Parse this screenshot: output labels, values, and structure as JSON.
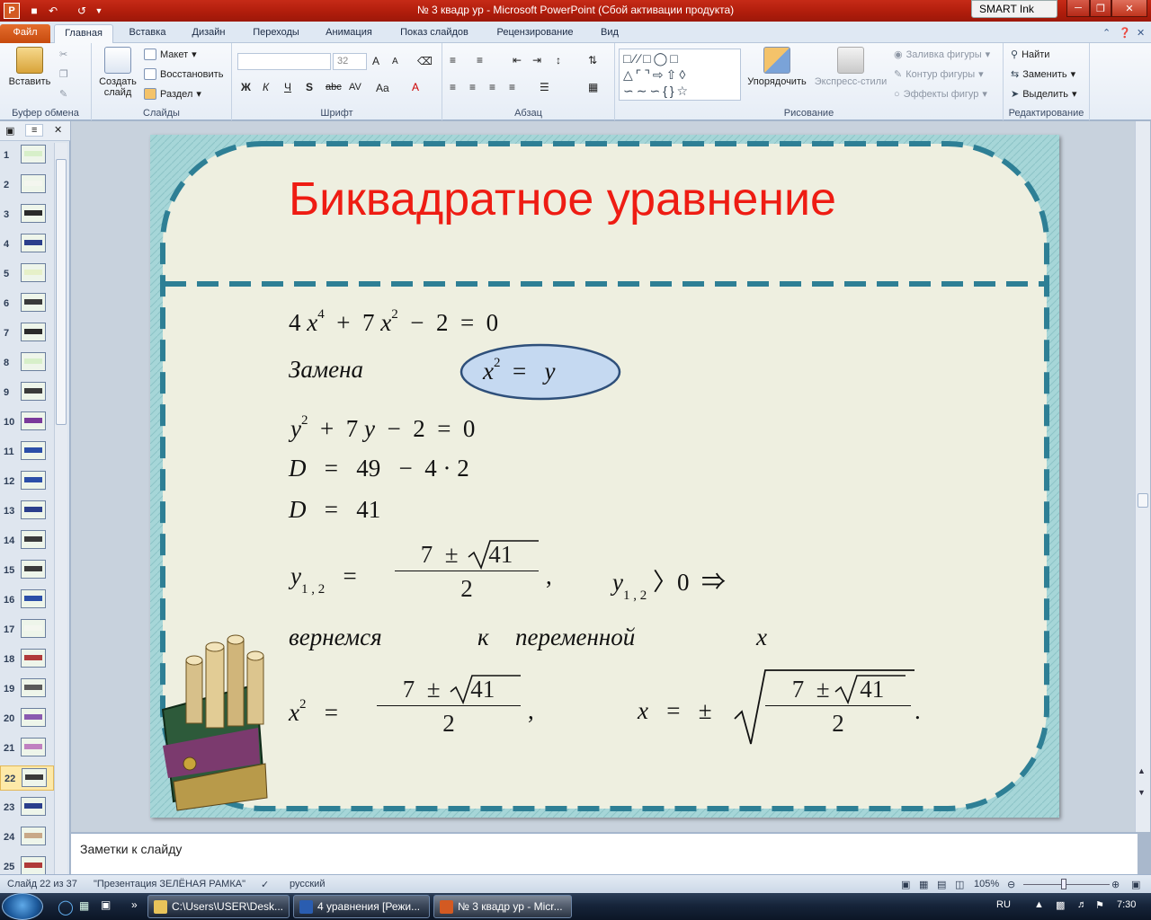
{
  "window": {
    "title": "№ 3 квадр ур  -  Microsoft PowerPoint (Сбой активации продукта)",
    "smart_ink": "SMART Ink",
    "app_icon_letter": "P"
  },
  "tabs": [
    "Файл",
    "Главная",
    "Вставка",
    "Дизайн",
    "Переходы",
    "Анимация",
    "Показ слайдов",
    "Рецензирование",
    "Вид"
  ],
  "ribbon": {
    "clipboard": {
      "label": "Буфер обмена",
      "paste": "Вставить"
    },
    "slides": {
      "label": "Слайды",
      "new_slide_1": "Создать",
      "new_slide_2": "слайд",
      "layout": "Макет",
      "reset": "Восстановить",
      "section": "Раздел"
    },
    "font": {
      "label": "Шрифт",
      "size": "32",
      "bold": "Ж",
      "italic": "К",
      "underline": "Ч",
      "shadow": "S",
      "strike": "abc",
      "spacing": "AV",
      "case": "Aa",
      "grow": "A",
      "shrink": "A",
      "color": "A"
    },
    "paragraph": {
      "label": "Абзац"
    },
    "drawing": {
      "label": "Рисование",
      "arrange": "Упорядочить",
      "quick_styles": "Экспресс-стили",
      "fill": "Заливка фигуры",
      "outline": "Контур фигуры",
      "effects": "Эффекты фигур"
    },
    "editing": {
      "label": "Редактирование",
      "find": "Найти",
      "replace": "Заменить",
      "select": "Выделить"
    }
  },
  "thumbnails": [
    "1",
    "2",
    "3",
    "4",
    "5",
    "6",
    "7",
    "8",
    "9",
    "10",
    "11",
    "12",
    "13",
    "14",
    "15",
    "16",
    "17",
    "18",
    "19",
    "20",
    "21",
    "22",
    "23",
    "24",
    "25"
  ],
  "selected_slide": "22",
  "slide": {
    "title": "Биквадратное уравнение",
    "eq1": {
      "a": "4",
      "x": "x",
      "p4": "4",
      "plus": "+",
      "b": "7",
      "p2": "2",
      "minus": "−",
      "c": "2",
      "eq": "=",
      "zero": "0"
    },
    "substitution": {
      "label": "Замена",
      "x": "x",
      "p2": "2",
      "eq": "=",
      "y": "y"
    },
    "eq2": {
      "y": "y",
      "p2": "2",
      "plus": "+",
      "b": "7",
      "minus": "−",
      "c": "2",
      "eq": "=",
      "zero": "0"
    },
    "disc1": {
      "d": "D",
      "eq": "=",
      "a": "49",
      "minus": "−",
      "b": "4",
      "dot": "·",
      "c": "2"
    },
    "disc2": {
      "d": "D",
      "eq": "=",
      "v": "41"
    },
    "roots_y": {
      "y": "y",
      "sub": "1 , 2",
      "eq": "=",
      "num_a": "7",
      "pm": "±",
      "root": "41",
      "den": "2",
      "comma": ",",
      "gt": "〉0",
      "implies": "⇒"
    },
    "back": {
      "w1": "вернемся",
      "w2": "к",
      "w3": "переменной",
      "w4": "x"
    },
    "roots_x2": {
      "x": "x",
      "p2": "2",
      "eq": "=",
      "num_a": "7",
      "pm": "±",
      "root": "41",
      "den": "2",
      "comma": ","
    },
    "roots_x": {
      "x": "x",
      "eq": "=",
      "pm": "±",
      "num_a": "7",
      "pm2": "±",
      "root": "41",
      "den": "2",
      "dot": "."
    }
  },
  "notes_placeholder": "Заметки к слайду",
  "status": {
    "slide_of": "Слайд 22 из 37",
    "theme": "\"Презентация ЗЕЛЁНАЯ РАМКА\"",
    "language": "русский",
    "zoom": "105%"
  },
  "taskbar": {
    "items": [
      "C:\\Users\\USER\\Desk...",
      "4 уравнения [Режи...",
      "№ 3 квадр ур - Micr..."
    ],
    "lang": "RU",
    "time": "7:30"
  },
  "colors": {
    "title_red": "#ee1c13",
    "frame_teal": "#2e7f95",
    "slide_bg": "#eeefe0",
    "highlight": "#c5d9f1"
  }
}
